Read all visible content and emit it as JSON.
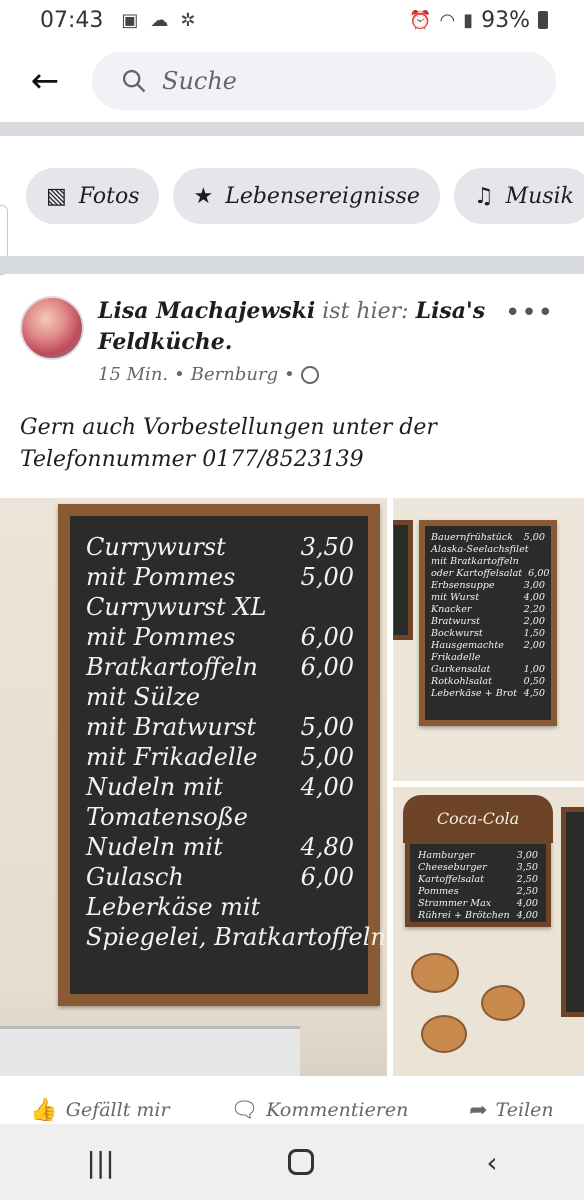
{
  "status_bar": {
    "time": "07:43",
    "battery": "93%"
  },
  "search": {
    "placeholder": "Suche"
  },
  "chips": [
    {
      "icon": "photos-icon",
      "label": "Fotos"
    },
    {
      "icon": "star-icon",
      "label": "Lebensereignisse"
    },
    {
      "icon": "music-icon",
      "label": "Musik"
    }
  ],
  "post": {
    "author": "Lisa Machajewski",
    "connector": "ist hier:",
    "place": "Lisa's Feldküche.",
    "time": "15 Min.",
    "location": "Bernburg",
    "separator": "•",
    "text": "Gern auch Vorbestellungen unter der Telefonnummer 0177/8523139"
  },
  "menu_main": [
    {
      "item": "Currywurst",
      "price": "3,50"
    },
    {
      "item": "mit Pommes",
      "price": "5,00"
    },
    {
      "item": "Currywurst XL",
      "price": ""
    },
    {
      "item": "mit Pommes",
      "price": "6,00"
    },
    {
      "item": "Bratkartoffeln",
      "price": "6,00"
    },
    {
      "item": "mit Sülze",
      "price": ""
    },
    {
      "item": "mit Bratwurst",
      "price": "5,00"
    },
    {
      "item": "mit Frikadelle",
      "price": "5,00"
    },
    {
      "item": "Nudeln mit",
      "price": "4,00"
    },
    {
      "item": "Tomatensoße",
      "price": ""
    },
    {
      "item": "Nudeln mit",
      "price": "4,80"
    },
    {
      "item": "Gulasch",
      "price": "6,00"
    },
    {
      "item": "Leberkäse mit",
      "price": ""
    },
    {
      "item": "Spiegelei, Bratkartoffeln",
      "price": ""
    }
  ],
  "menu_side": [
    {
      "item": "Bauernfrühstück",
      "price": "5,00"
    },
    {
      "item": "Alaska-Seelachsfilet",
      "price": ""
    },
    {
      "item": "mit Bratkartoffeln",
      "price": ""
    },
    {
      "item": "oder Kartoffelsalat",
      "price": "6,00"
    },
    {
      "item": "Erbsensuppe",
      "price": "3,00"
    },
    {
      "item": "mit Wurst",
      "price": "4,00"
    },
    {
      "item": "Knacker",
      "price": "2,20"
    },
    {
      "item": "Bratwurst",
      "price": "2,00"
    },
    {
      "item": "Bockwurst",
      "price": "1,50"
    },
    {
      "item": "Hausgemachte",
      "price": "2,00"
    },
    {
      "item": "Frikadelle",
      "price": ""
    },
    {
      "item": "Gurkensalat",
      "price": "1,00"
    },
    {
      "item": "Rotkohlsalat",
      "price": "0,50"
    },
    {
      "item": "Leberkäse + Brot",
      "price": "4,50"
    }
  ],
  "menu_small": [
    {
      "item": "Hamburger",
      "price": "3,00"
    },
    {
      "item": "Cheeseburger",
      "price": "3,50"
    },
    {
      "item": "Kartoffelsalat",
      "price": "2,50"
    },
    {
      "item": "Pommes",
      "price": "2,50"
    },
    {
      "item": "Strammer Max",
      "price": "4,00"
    },
    {
      "item": "Rührei + Brötchen",
      "price": "4,00"
    }
  ],
  "sign": {
    "brand": "Coca-Cola"
  },
  "actions": {
    "like": "Gefällt mir",
    "comment": "Kommentieren",
    "share": "Teilen"
  },
  "colors": {
    "chip_bg": "#e4e6eb",
    "search_bg": "#f0f2f5",
    "frame": "#8a5a35",
    "board": "#2b2c2a"
  }
}
